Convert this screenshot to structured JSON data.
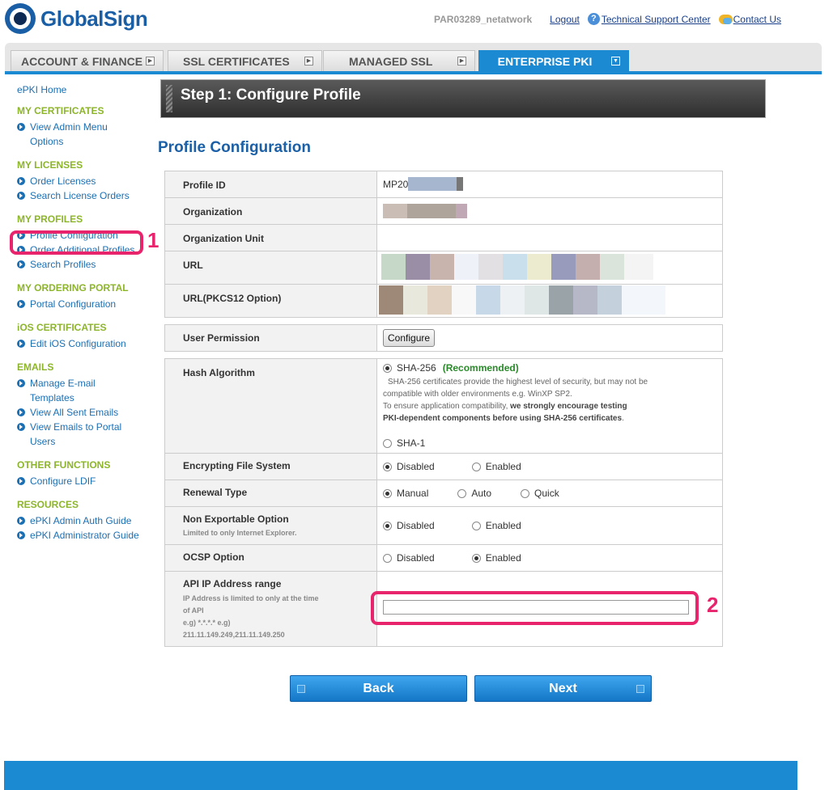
{
  "header": {
    "logo_text": "GlobalSign",
    "account_id": "PAR03289_netatwork",
    "logout": "Logout",
    "support": "Technical Support Center",
    "contact": "Contact Us"
  },
  "tabs": [
    {
      "label": "ACCOUNT & FINANCE"
    },
    {
      "label": "SSL CERTIFICATES"
    },
    {
      "label": "MANAGED SSL"
    },
    {
      "label": "ENTERPRISE PKI"
    }
  ],
  "sidebar": {
    "home": "ePKI Home",
    "groups": [
      {
        "title": "MY CERTIFICATES",
        "items": [
          "View Admin Menu Options"
        ]
      },
      {
        "title": "MY LICENSES",
        "items": [
          "Order Licenses",
          "Search License Orders"
        ]
      },
      {
        "title": "MY PROFILES",
        "items": [
          "Profile Configuration",
          "Order Additional Profiles",
          "Search Profiles"
        ]
      },
      {
        "title": "MY ORDERING PORTAL",
        "items": [
          "Portal Configuration"
        ]
      },
      {
        "title": "iOS CERTIFICATES",
        "items": [
          "Edit iOS Configuration"
        ]
      },
      {
        "title": "EMAILS",
        "items": [
          "Manage E-mail Templates",
          "View All Sent Emails",
          "View Emails to Portal Users"
        ]
      },
      {
        "title": "OTHER FUNCTIONS",
        "items": [
          "Configure LDIF"
        ]
      },
      {
        "title": "RESOURCES",
        "items": [
          "ePKI Admin Auth Guide",
          "ePKI Administrator Guide"
        ]
      }
    ]
  },
  "annotations": {
    "one": "1",
    "two": "2"
  },
  "step_title": "Step 1: Configure Profile",
  "section_title": "Profile Configuration",
  "form": {
    "profile_id_label": "Profile ID",
    "profile_id_value": "MP20",
    "organization_label": "Organization",
    "org_unit_label": "Organization Unit",
    "url_label": "URL",
    "url_pkcs12_label": "URL(PKCS12 Option)",
    "user_permission_label": "User Permission",
    "configure_button": "Configure",
    "hash_label": "Hash Algorithm",
    "sha256": "SHA-256",
    "recommended": "(Recommended)",
    "hash_note1": "SHA-256 certificates provide the highest level of security, but may not be",
    "hash_note2": "compatible with older environments e.g. WinXP SP2.",
    "hash_note3": "To ensure application compatibility, ",
    "hash_note3b": "we strongly encourage testing",
    "hash_note4": "PKI-dependent components before using SHA-256 certificates",
    "hash_note4b": ".",
    "sha1": "SHA-1",
    "efs_label": "Encrypting File System",
    "disabled": "Disabled",
    "enabled": "Enabled",
    "renewal_label": "Renewal Type",
    "manual": "Manual",
    "auto": "Auto",
    "quick": "Quick",
    "nonexport_label": "Non Exportable Option",
    "nonexport_sub": "Limited to only Internet Explorer.",
    "ocsp_label": "OCSP Option",
    "api_label": "API IP Address range",
    "api_sub1": "IP Address is limited to only at the time",
    "api_sub2": "of API",
    "api_sub3": "e.g) *.*.*.* e.g)",
    "api_sub4": "211.11.149.249,211.11.149.250",
    "api_value": ""
  },
  "buttons": {
    "back": "Back",
    "next": "Next"
  }
}
